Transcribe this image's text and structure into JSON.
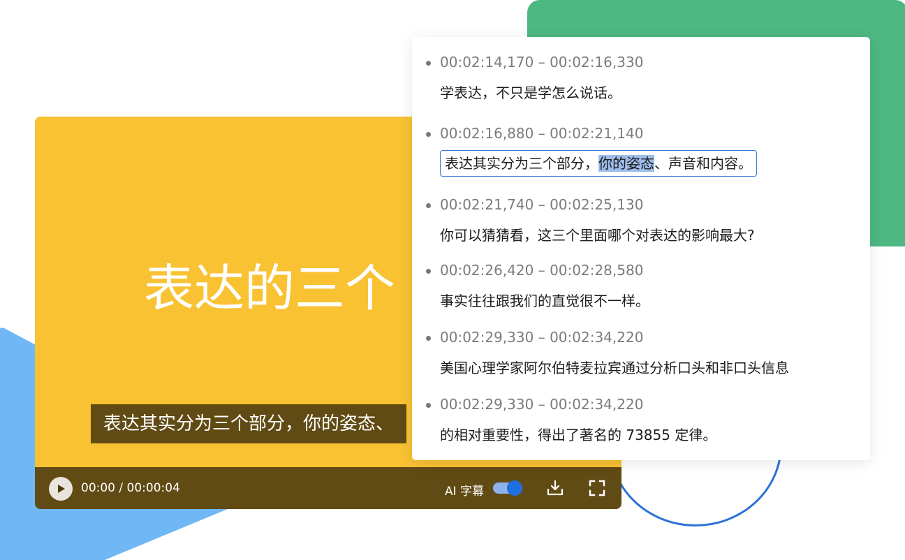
{
  "player": {
    "title": "表达的三个",
    "subtitle": "表达其实分为三个部分，你的姿态、",
    "time": "00:00 / 00:00:04",
    "ai_subtitle_label": "AI 字幕",
    "ai_subtitle_enabled": true,
    "play_icon": "play-icon",
    "download_icon": "download-icon",
    "fullscreen_icon": "fullscreen-icon"
  },
  "subtitles": [
    {
      "time": "00:02:14,170 – 00:02:16,330",
      "text": "学表达，不只是学怎么说话。"
    },
    {
      "time": "00:02:16,880 – 00:02:21,140",
      "text_before": "表达其实分为三个部分，",
      "text_selected": "你的姿态",
      "text_after": "、声音和内容。"
    },
    {
      "time": "00:02:21,740 – 00:02:25,130",
      "text": "你可以猜猜看，这三个里面哪个对表达的影响最大?"
    },
    {
      "time": "00:02:26,420 – 00:02:28,580",
      "text": "事实往往跟我们的直觉很不一样。"
    },
    {
      "time": "00:02:29,330 – 00:02:34,220",
      "text": "美国心理学家阿尔伯特麦拉宾通过分析口头和非口头信息"
    },
    {
      "time": "00:02:29,330 – 00:02:34,220",
      "text": "的相对重要性，得出了著名的 73855 定律。"
    }
  ],
  "colors": {
    "player_bg": "#f9c233",
    "controls_bg": "#614b14",
    "green_block": "#4db882",
    "blue_shape": "#6fb8f5",
    "ring": "#2a73d6",
    "highlight": "#9dbcea"
  }
}
